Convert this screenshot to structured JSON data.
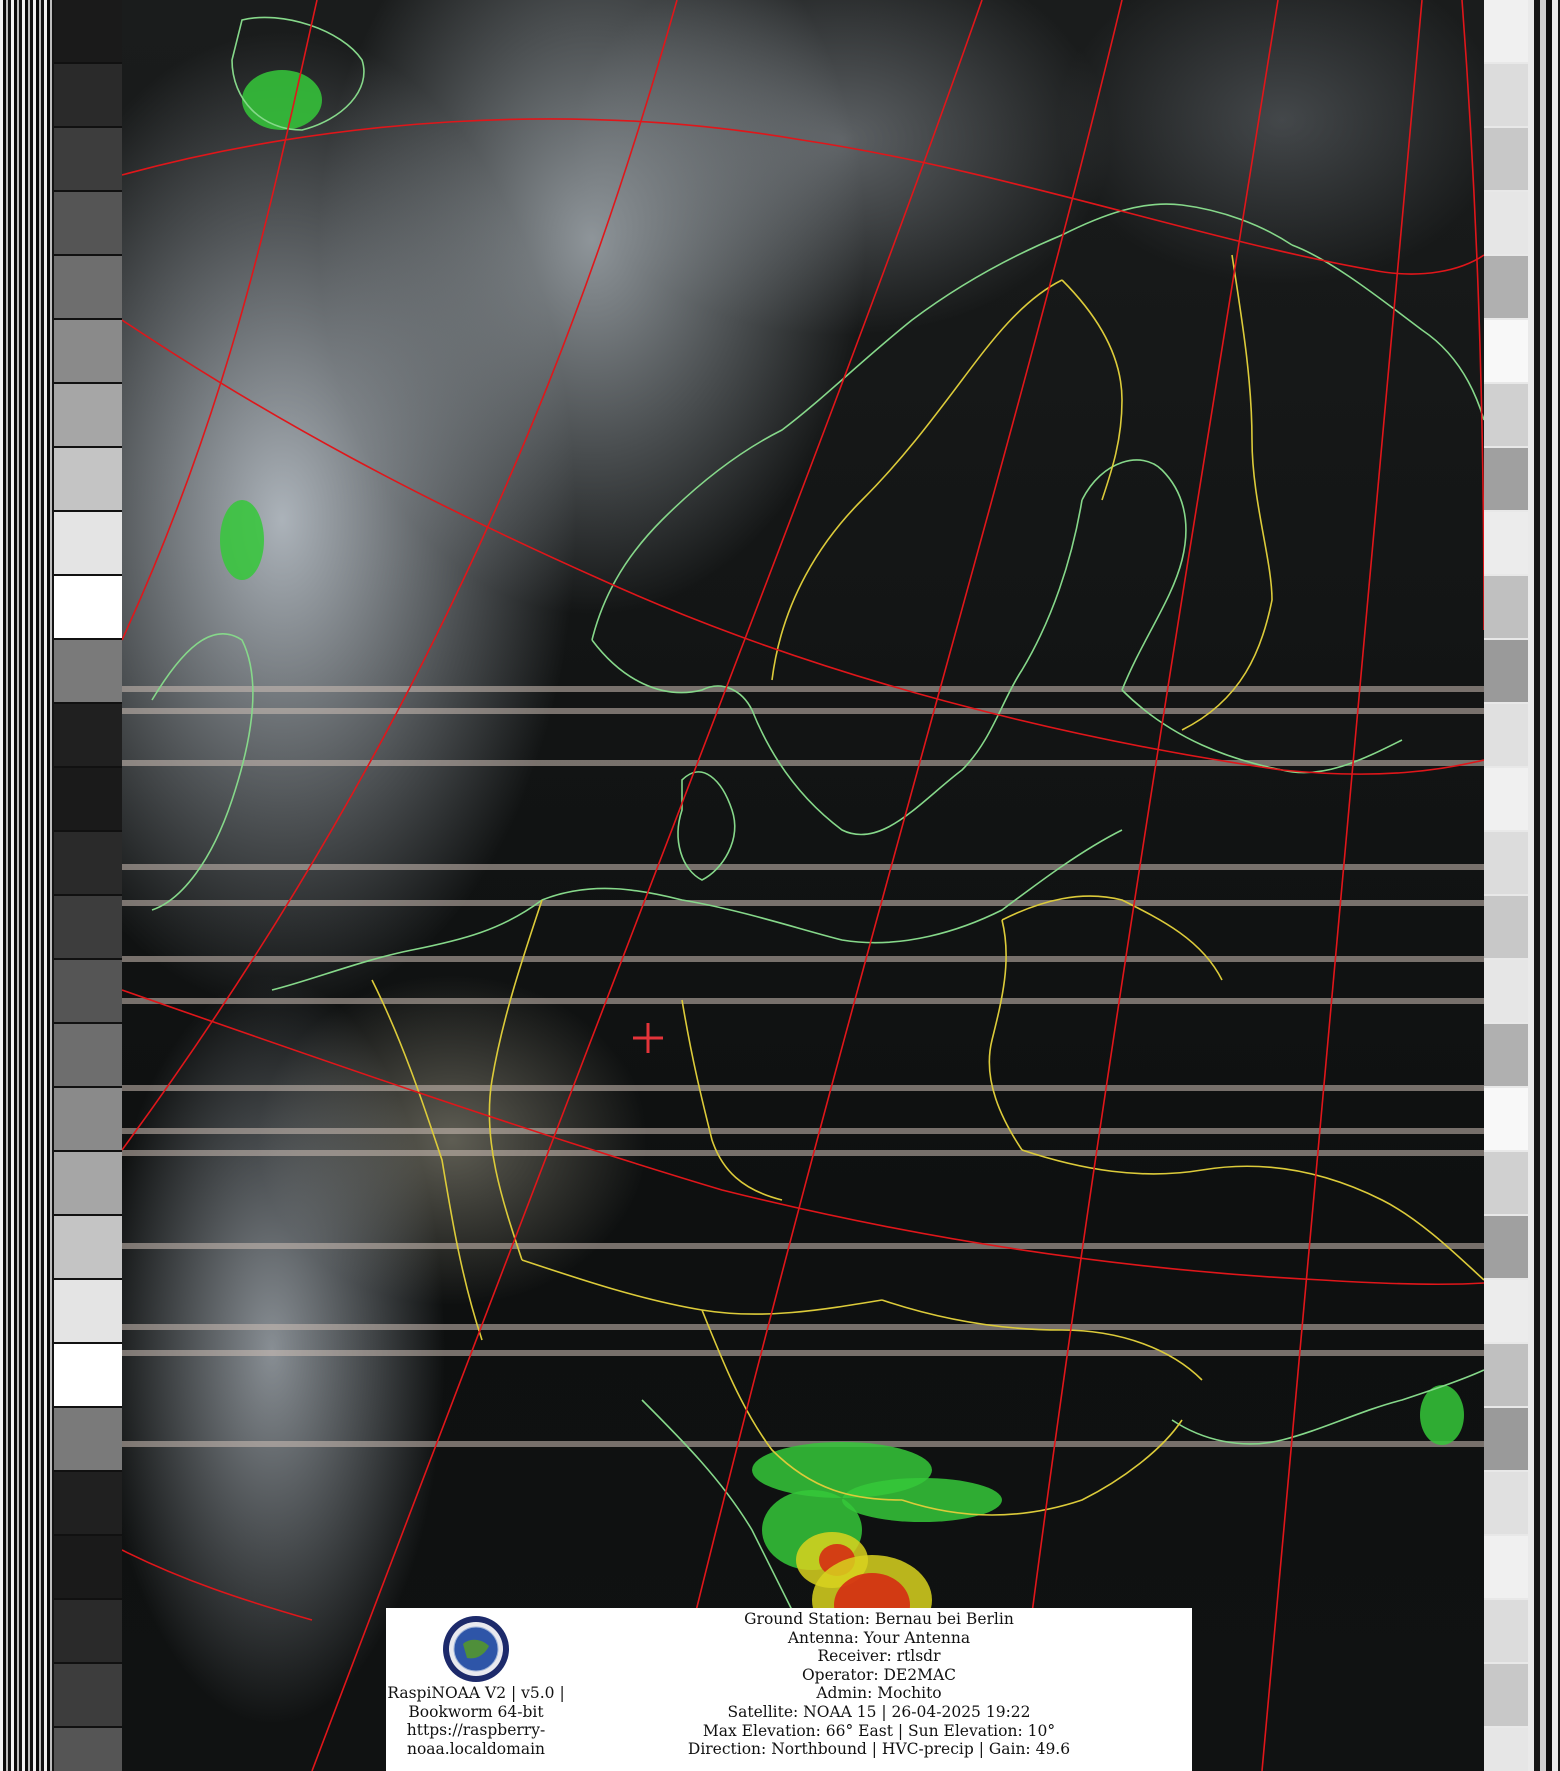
{
  "colors": {
    "graticule": "#e0161a",
    "coastline": "#86d88a",
    "borders": "#dccb3a",
    "marker": "#e5343a",
    "precip_light": "#35c83a",
    "precip_mid": "#d8d21e",
    "precip_heavy": "#d62412"
  },
  "overlay": {
    "logo_icon": "satellite-logo-icon",
    "logo_lines": [
      "RaspiNOAA V2 | v5.0 |",
      "Bookworm 64-bit",
      "https://raspberry-",
      "noaa.localdomain"
    ],
    "station_lines": [
      "Ground Station: Bernau bei Berlin",
      "Antenna: Your Antenna",
      "Receiver: rtlsdr",
      "Operator: DE2MAC",
      "Admin: Mochito",
      "Satellite: NOAA 15 | 26-04-2025 19:22",
      "Max Elevation: 66° East | Sun Elevation: 10°",
      "Direction: Northbound | HVC-precip | Gain: 49.6"
    ]
  }
}
